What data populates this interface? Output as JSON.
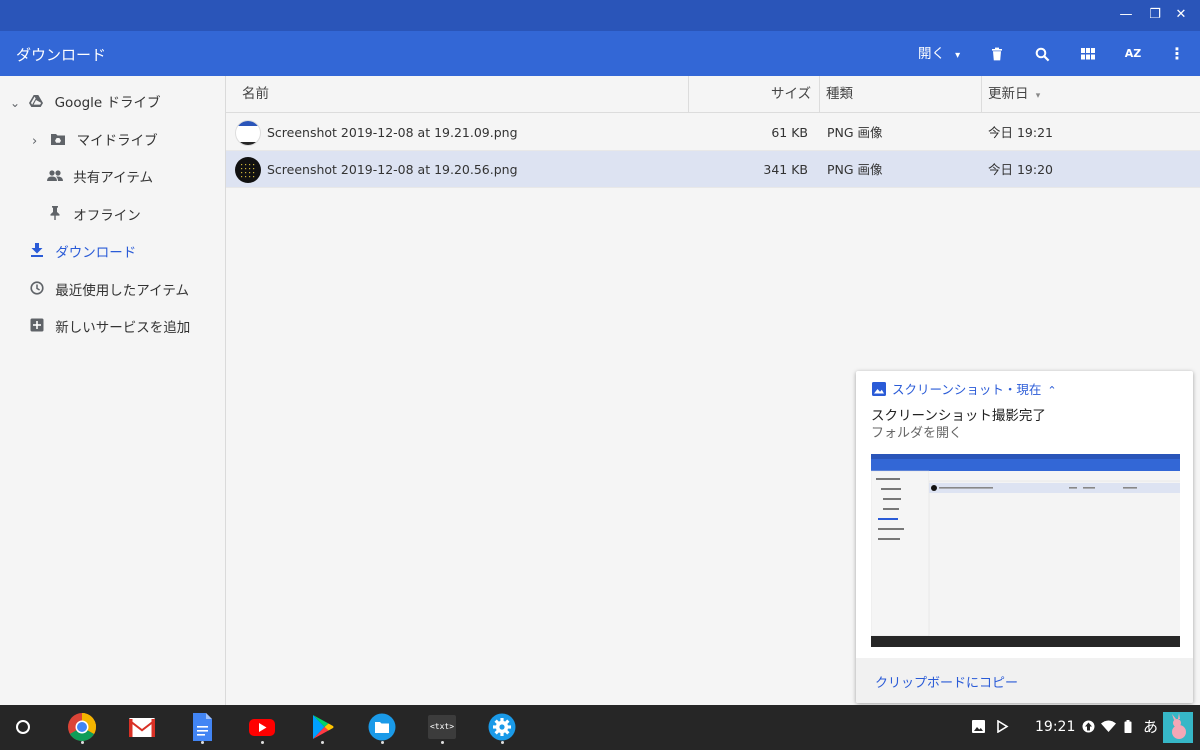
{
  "header": {
    "title": "ダウンロード",
    "open_label": "開く",
    "open_caret": "▾",
    "window_controls": {
      "minimize": "—",
      "restore": "❐",
      "close": "✕"
    },
    "icons": [
      "delete-icon",
      "search-icon",
      "grid-view-icon",
      "sort-az-icon",
      "more-vert-icon"
    ],
    "sort_label": "AZ",
    "more_label": "⋮"
  },
  "sidebar": {
    "items": [
      {
        "label": "Google ドライブ",
        "icon": "google-drive-icon",
        "expander": "⌄"
      },
      {
        "label": "マイドライブ",
        "icon": "my-drive-icon",
        "expander": "›"
      },
      {
        "label": "共有アイテム",
        "icon": "shared-icon"
      },
      {
        "label": "オフライン",
        "icon": "pin-icon"
      },
      {
        "label": "ダウンロード",
        "icon": "download-icon"
      },
      {
        "label": "最近使用したアイテム",
        "icon": "clock-icon"
      },
      {
        "label": "新しいサービスを追加",
        "icon": "add-box-icon"
      }
    ]
  },
  "table": {
    "columns": {
      "name": "名前",
      "size": "サイズ",
      "type": "種類",
      "modified": "更新日",
      "sort_indicator": "▾"
    },
    "rows": [
      {
        "name": "Screenshot 2019-12-08 at 19.21.09.png",
        "size": "61 KB",
        "type": "PNG 画像",
        "modified": "今日 19:21"
      },
      {
        "name": "Screenshot 2019-12-08 at 19.20.56.png",
        "size": "341 KB",
        "type": "PNG 画像",
        "modified": "今日 19:20"
      }
    ]
  },
  "notification": {
    "source": "スクリーンショット・現在",
    "caret": "⌃",
    "title": "スクリーンショット撮影完了",
    "subtitle": "フォルダを開く",
    "action": "クリップボードにコピー"
  },
  "shelf": {
    "apps": [
      "launcher",
      "chrome",
      "gmail",
      "docs",
      "youtube",
      "play-store",
      "files",
      "terminal",
      "settings"
    ],
    "terminal_label": "<txt>",
    "time": "19:21",
    "ime": "あ"
  },
  "colors": {
    "titlebar": "#2a55b9",
    "appbar": "#3367d6",
    "accent": "#2a5bd7",
    "selection": "#dde3f2",
    "shelf": "#262626"
  }
}
